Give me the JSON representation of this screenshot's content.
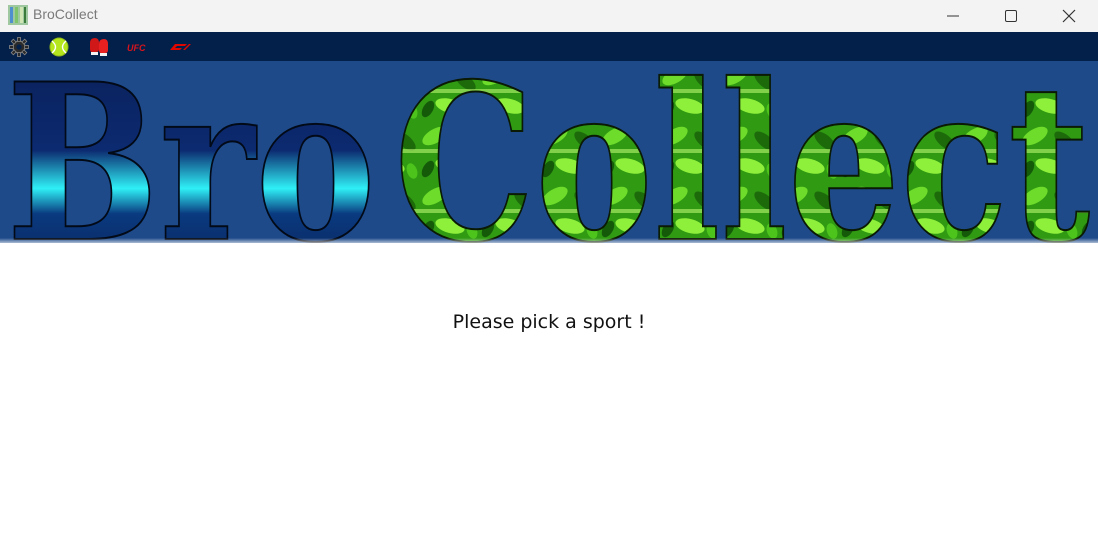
{
  "window": {
    "title": "BroCollect",
    "controls": [
      "minimize-icon",
      "maximize-icon",
      "close-icon"
    ]
  },
  "toolbar": {
    "items": [
      {
        "name": "settings",
        "icon": "gear-icon"
      },
      {
        "name": "tennis",
        "icon": "tennis-ball-icon"
      },
      {
        "name": "boxing",
        "icon": "boxing-gloves-icon"
      },
      {
        "name": "ufc",
        "icon": "ufc-logo-icon",
        "label": "UFC"
      },
      {
        "name": "f1",
        "icon": "f1-logo-icon"
      }
    ]
  },
  "banner": {
    "text_part1": "Bro",
    "text_part2": "Collect"
  },
  "main": {
    "prompt": "Please pick a sport !"
  },
  "colors": {
    "toolbar_bg": "#03204a",
    "banner_bg": "#1e4a8a",
    "bro_fill": "#0a2a6a",
    "bro_highlight": "#1fe0ee",
    "collect_fill": "#3fbf1a",
    "collect_highlight": "#a8ff50",
    "ufc_red": "#d9141c",
    "f1_red": "#e10600"
  }
}
